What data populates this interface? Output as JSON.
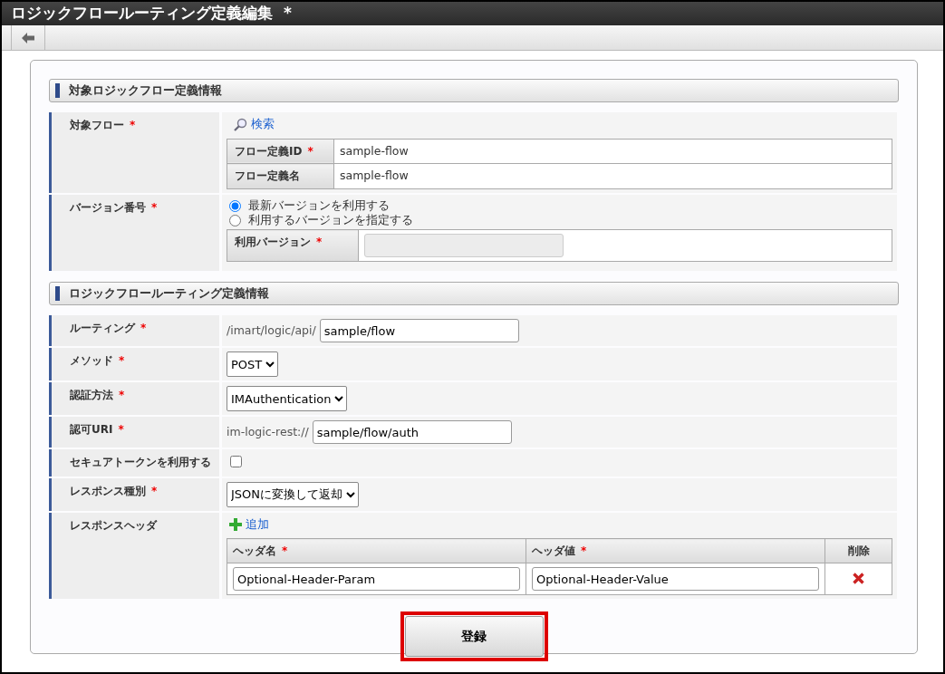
{
  "window": {
    "title": "ロジックフロールーティング定義編集",
    "modified_mark": "*"
  },
  "sections": [
    {
      "title": "対象ロジックフロー定義情報",
      "rows": [
        {
          "kind": "flow",
          "label": "対象フロー",
          "mark": "*",
          "search_link": "検索",
          "table": [
            {
              "label": "フロー定義ID",
              "mark": "*",
              "value": "sample-flow"
            },
            {
              "label": "フロー定義名",
              "value": "sample-flow"
            }
          ]
        },
        {
          "kind": "version",
          "label": "バージョン番号",
          "mark": "*",
          "options": [
            {
              "label": "最新バージョンを利用する",
              "selected": true
            },
            {
              "label": "利用するバージョンを指定する",
              "selected": false
            }
          ],
          "sub_label": "利用バージョン",
          "sub_mark": "*",
          "sub_disabled": true
        }
      ]
    },
    {
      "title": "ロジックフロールーティング定義情報",
      "rows": [
        {
          "kind": "prefixed-text",
          "label": "ルーティング",
          "mark": "*",
          "prefix": "/imart/logic/api/",
          "value": "sample/flow"
        },
        {
          "kind": "select",
          "label": "メソッド",
          "mark": "*",
          "value": "POST"
        },
        {
          "kind": "select",
          "label": "認証方法",
          "mark": "*",
          "value": "IMAuthentication"
        },
        {
          "kind": "prefixed-text",
          "label": "認可URI",
          "mark": "*",
          "prefix": "im-logic-rest://",
          "value": "sample/flow/auth"
        },
        {
          "kind": "checkbox",
          "label": "セキュアトークンを利用する",
          "checked": false
        },
        {
          "kind": "select",
          "label": "レスポンス種別",
          "mark": "*",
          "value": "JSONに変換して返却"
        },
        {
          "kind": "headers",
          "label": "レスポンスヘッダ",
          "add_link": "追加",
          "columns": [
            {
              "label": "ヘッダ名",
              "mark": "*"
            },
            {
              "label": "ヘッダ値",
              "mark": "*"
            },
            {
              "label": "削除"
            }
          ],
          "rows": [
            {
              "name": "Optional-Header-Param",
              "value": "Optional-Header-Value"
            }
          ]
        }
      ]
    }
  ],
  "submit": {
    "label": "登録",
    "highlighted": true
  }
}
